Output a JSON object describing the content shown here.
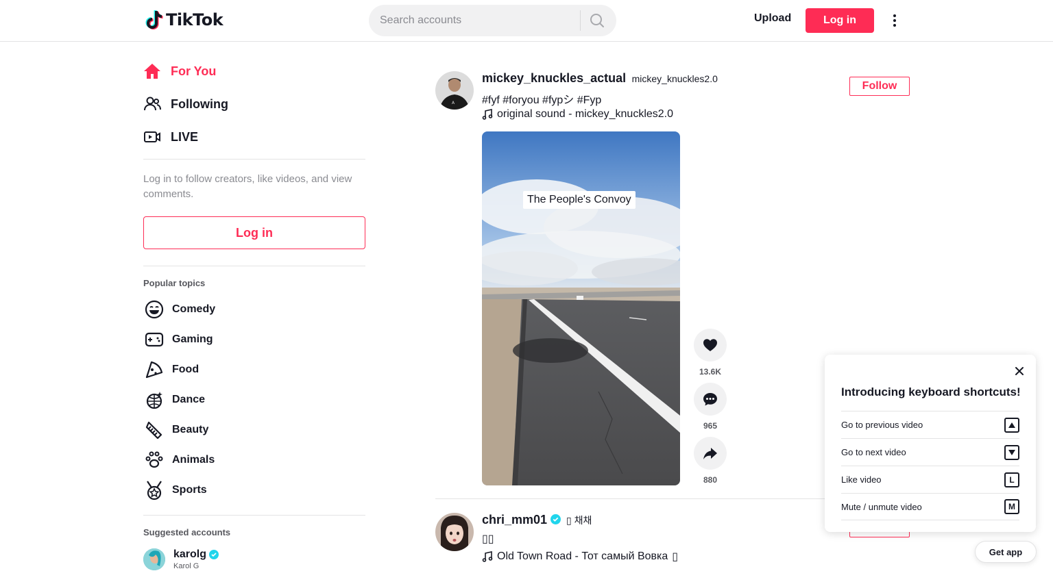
{
  "header": {
    "logo_text": "TikTok",
    "search_placeholder": "Search accounts",
    "upload_label": "Upload",
    "login_label": "Log in",
    "brand_color": "#fe2c55"
  },
  "sidebar": {
    "nav": [
      {
        "label": "For You",
        "icon": "home-icon",
        "active": true
      },
      {
        "label": "Following",
        "icon": "users-icon",
        "active": false
      },
      {
        "label": "LIVE",
        "icon": "live-icon",
        "active": false
      }
    ],
    "login_prompt": "Log in to follow creators, like videos, and view comments.",
    "login_button": "Log in",
    "popular_title": "Popular topics",
    "topics": [
      {
        "label": "Comedy",
        "icon": "smile-icon"
      },
      {
        "label": "Gaming",
        "icon": "gamepad-icon"
      },
      {
        "label": "Food",
        "icon": "pizza-icon"
      },
      {
        "label": "Dance",
        "icon": "disco-ball-icon"
      },
      {
        "label": "Beauty",
        "icon": "comb-icon"
      },
      {
        "label": "Animals",
        "icon": "paw-icon"
      },
      {
        "label": "Sports",
        "icon": "medal-icon"
      }
    ],
    "suggested_title": "Suggested accounts",
    "suggested": [
      {
        "username": "karolg",
        "display": "Karol G",
        "verified": true
      }
    ]
  },
  "posts": [
    {
      "username": "mickey_knuckles_actual",
      "nickname": "mickey_knuckles2.0",
      "caption": "#fyf #foryou #fypシ #Fyp",
      "music": "original sound - mickey_knuckles2.0",
      "follow_label": "Follow",
      "video_overlay": "The People's Convoy",
      "likes": "13.6K",
      "comments": "965",
      "shares": "880"
    },
    {
      "username": "chri_mm01",
      "nickname": "채채",
      "caption": "",
      "music": "Old Town Road - Тот самый Вовка",
      "follow_label": "Follow"
    }
  ],
  "shortcuts": {
    "title": "Introducing keyboard shortcuts!",
    "rows": [
      {
        "label": "Go to previous video",
        "key": "▲"
      },
      {
        "label": "Go to next video",
        "key": "▼"
      },
      {
        "label": "Like video",
        "key": "L"
      },
      {
        "label": "Mute / unmute video",
        "key": "M"
      }
    ]
  },
  "get_app_label": "Get app"
}
